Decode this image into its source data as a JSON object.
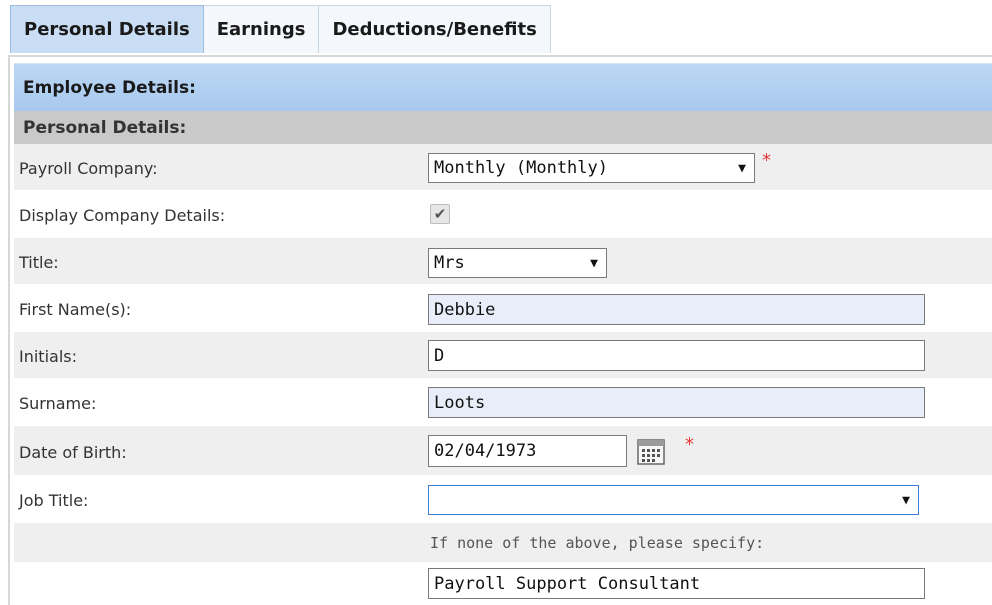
{
  "tabs": [
    {
      "label": "Personal Details",
      "active": true
    },
    {
      "label": "Earnings",
      "active": false
    },
    {
      "label": "Deductions/Benefits",
      "active": false
    }
  ],
  "employee_header": "Employee Details:",
  "section_header": "Personal Details:",
  "fields": {
    "payroll_company": {
      "label": "Payroll Company:",
      "value": "Monthly (Monthly)",
      "required_mark": "*"
    },
    "display_company": {
      "label": "Display Company Details:",
      "checked": true,
      "check_glyph": "✔"
    },
    "title": {
      "label": "Title:",
      "value": "Mrs"
    },
    "first_name": {
      "label": "First Name(s):",
      "value": "Debbie"
    },
    "initials": {
      "label": "Initials:",
      "value": "D"
    },
    "surname": {
      "label": "Surname:",
      "value": "Loots"
    },
    "dob": {
      "label": "Date of Birth:",
      "value": "02/04/1973",
      "required_mark": "*"
    },
    "job_title": {
      "label": "Job Title:",
      "value": ""
    },
    "job_hint": "If none of the above, please specify:",
    "job_specify": {
      "value": "Payroll Support Consultant"
    }
  },
  "icons": {
    "dropdown": "▼",
    "calendar": "calendar-icon"
  },
  "colors": {
    "tab_active": "#c9def5",
    "header_blue": "#a8c9ee",
    "section_grey": "#c9c9c9",
    "required": "#e23a3a",
    "input_blue": "#e8eef9"
  }
}
